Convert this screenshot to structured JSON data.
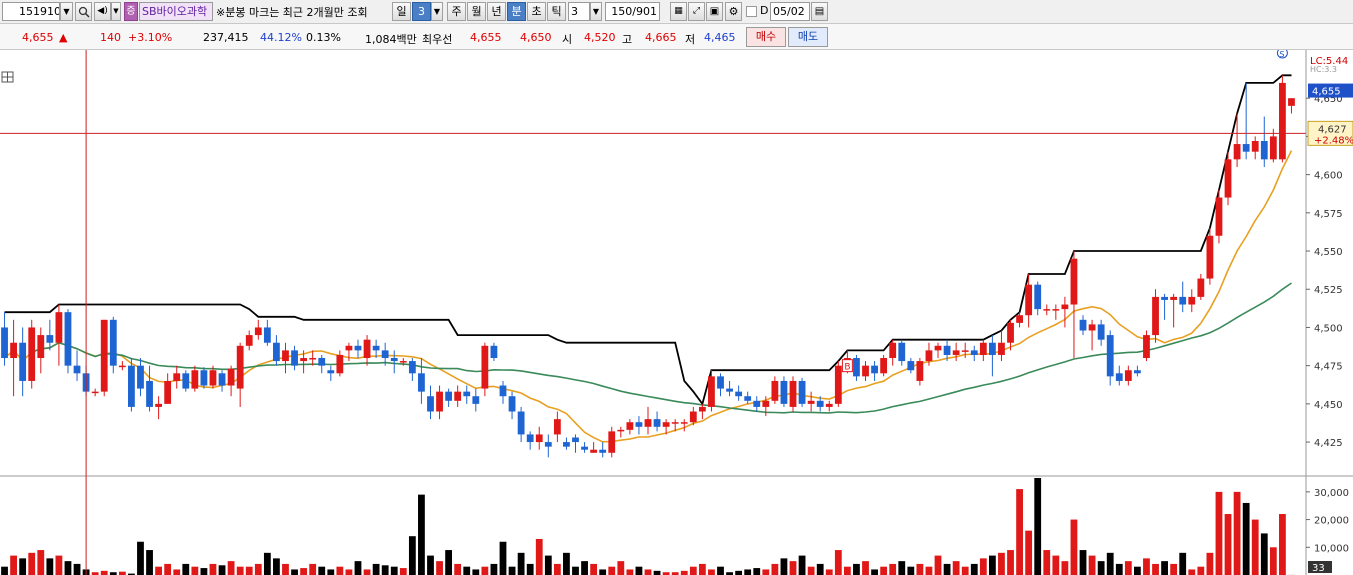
{
  "toolbar": {
    "code": "151910",
    "stock_name": "SB바이오과학",
    "notice": "※분봉 마크는 최근 2개월만 조회",
    "period_day": "일",
    "period_num": "3",
    "week": "주",
    "month": "월",
    "year": "년",
    "minute": "분",
    "second": "초",
    "tick": "틱",
    "interval": "3",
    "count": "150",
    "total": "/901",
    "d_label": "D",
    "date": "05/02"
  },
  "quote": {
    "price": "4,655",
    "change": "140",
    "change_pct": "+3.10%",
    "volume": "237,415",
    "vol_ratio": "44.12%",
    "turnover_pct": "0.13%",
    "amount": "1,084백만",
    "best_label": "최우선",
    "ask": "4,655",
    "bid": "4,650",
    "open_label": "시",
    "open": "4,520",
    "high_label": "고",
    "high": "4,665",
    "low_label": "저",
    "low": "4,465",
    "buy": "매수",
    "sell": "매도"
  },
  "price_axis": {
    "ticks": [
      "4,650",
      "4,625",
      "4,600",
      "4,575",
      "4,550",
      "4,525",
      "4,500",
      "4,475",
      "4,450",
      "4,425"
    ],
    "current_badge": "4,655",
    "cursor_price": "4,627",
    "cursor_pct": "+2.48%",
    "lc_label": "LC:5.44",
    "hc_label": "HC:3.3"
  },
  "volume_axis": {
    "ticks": [
      "30,000",
      "20,000",
      "10,000"
    ],
    "current": "33"
  },
  "colors": {
    "up": "#e01818",
    "down": "#1e64d2",
    "ma_short": "#e8a020",
    "ma_long": "#3a8a5a",
    "envelope": "#000000",
    "cursor": "#cc2020"
  },
  "chart_data": {
    "type": "candlestick",
    "y_price_range": [
      4410,
      4675
    ],
    "y_volume_range": [
      0,
      35000
    ],
    "markers": [
      "B",
      "S"
    ],
    "candles": [
      {
        "o": 4500,
        "h": 4510,
        "l": 4475,
        "c": 4480,
        "v": 3000
      },
      {
        "o": 4480,
        "h": 4505,
        "l": 4455,
        "c": 4490,
        "v": 7000
      },
      {
        "o": 4490,
        "h": 4500,
        "l": 4455,
        "c": 4465,
        "v": 6000
      },
      {
        "o": 4465,
        "h": 4505,
        "l": 4460,
        "c": 4500,
        "v": 8000
      },
      {
        "o": 4480,
        "h": 4500,
        "l": 4470,
        "c": 4495,
        "v": 9000
      },
      {
        "o": 4495,
        "h": 4505,
        "l": 4485,
        "c": 4490,
        "v": 6000
      },
      {
        "o": 4490,
        "h": 4515,
        "l": 4475,
        "c": 4510,
        "v": 7000
      },
      {
        "o": 4510,
        "h": 4512,
        "l": 4470,
        "c": 4475,
        "v": 5000
      },
      {
        "o": 4475,
        "h": 4485,
        "l": 4465,
        "c": 4470,
        "v": 4000
      },
      {
        "o": 4470,
        "h": 4475,
        "l": 4455,
        "c": 4458,
        "v": 2000
      },
      {
        "o": 4458,
        "h": 4460,
        "l": 4455,
        "c": 4458,
        "v": 1000
      },
      {
        "o": 4458,
        "h": 4505,
        "l": 4455,
        "c": 4505,
        "v": 1500
      },
      {
        "o": 4505,
        "h": 4507,
        "l": 4470,
        "c": 4475,
        "v": 1000
      },
      {
        "o": 4475,
        "h": 4478,
        "l": 4472,
        "c": 4475,
        "v": 1200
      },
      {
        "o": 4475,
        "h": 4480,
        "l": 4445,
        "c": 4448,
        "v": 500
      },
      {
        "o": 4475,
        "h": 4480,
        "l": 4455,
        "c": 4460,
        "v": 12000
      },
      {
        "o": 4465,
        "h": 4475,
        "l": 4445,
        "c": 4448,
        "v": 9000
      },
      {
        "o": 4448,
        "h": 4455,
        "l": 4440,
        "c": 4450,
        "v": 3000
      },
      {
        "o": 4450,
        "h": 4470,
        "l": 4450,
        "c": 4465,
        "v": 4000
      },
      {
        "o": 4465,
        "h": 4475,
        "l": 4460,
        "c": 4470,
        "v": 2000
      },
      {
        "o": 4470,
        "h": 4472,
        "l": 4458,
        "c": 4460,
        "v": 4000
      },
      {
        "o": 4460,
        "h": 4475,
        "l": 4458,
        "c": 4472,
        "v": 3000
      },
      {
        "o": 4472,
        "h": 4474,
        "l": 4460,
        "c": 4462,
        "v": 2500
      },
      {
        "o": 4462,
        "h": 4475,
        "l": 4460,
        "c": 4472,
        "v": 4000
      },
      {
        "o": 4470,
        "h": 4472,
        "l": 4458,
        "c": 4462,
        "v": 3500
      },
      {
        "o": 4462,
        "h": 4475,
        "l": 4455,
        "c": 4473,
        "v": 5000
      },
      {
        "o": 4460,
        "h": 4490,
        "l": 4448,
        "c": 4488,
        "v": 3000
      },
      {
        "o": 4488,
        "h": 4498,
        "l": 4485,
        "c": 4495,
        "v": 3000
      },
      {
        "o": 4495,
        "h": 4505,
        "l": 4492,
        "c": 4500,
        "v": 4000
      },
      {
        "o": 4500,
        "h": 4505,
        "l": 4488,
        "c": 4490,
        "v": 8000
      },
      {
        "o": 4490,
        "h": 4495,
        "l": 4475,
        "c": 4478,
        "v": 6000
      },
      {
        "o": 4478,
        "h": 4490,
        "l": 4470,
        "c": 4485,
        "v": 4000
      },
      {
        "o": 4485,
        "h": 4488,
        "l": 4472,
        "c": 4475,
        "v": 2000
      },
      {
        "o": 4478,
        "h": 4485,
        "l": 4470,
        "c": 4480,
        "v": 2500
      },
      {
        "o": 4480,
        "h": 4485,
        "l": 4475,
        "c": 4480,
        "v": 4000
      },
      {
        "o": 4480,
        "h": 4482,
        "l": 4470,
        "c": 4475,
        "v": 3000
      },
      {
        "o": 4472,
        "h": 4475,
        "l": 4465,
        "c": 4470,
        "v": 2000
      },
      {
        "o": 4470,
        "h": 4485,
        "l": 4468,
        "c": 4482,
        "v": 3000
      },
      {
        "o": 4485,
        "h": 4490,
        "l": 4478,
        "c": 4488,
        "v": 2000
      },
      {
        "o": 4488,
        "h": 4492,
        "l": 4480,
        "c": 4485,
        "v": 5000
      },
      {
        "o": 4480,
        "h": 4495,
        "l": 4475,
        "c": 4492,
        "v": 2000
      },
      {
        "o": 4488,
        "h": 4492,
        "l": 4480,
        "c": 4485,
        "v": 4000
      },
      {
        "o": 4485,
        "h": 4490,
        "l": 4475,
        "c": 4480,
        "v": 3500
      },
      {
        "o": 4480,
        "h": 4485,
        "l": 4470,
        "c": 4478,
        "v": 3000
      },
      {
        "o": 4478,
        "h": 4480,
        "l": 4475,
        "c": 4478,
        "v": 2500
      },
      {
        "o": 4478,
        "h": 4480,
        "l": 4465,
        "c": 4470,
        "v": 14000
      },
      {
        "o": 4470,
        "h": 4480,
        "l": 4450,
        "c": 4458,
        "v": 29000
      },
      {
        "o": 4455,
        "h": 4462,
        "l": 4440,
        "c": 4445,
        "v": 7000
      },
      {
        "o": 4445,
        "h": 4462,
        "l": 4440,
        "c": 4458,
        "v": 5000
      },
      {
        "o": 4458,
        "h": 4460,
        "l": 4448,
        "c": 4452,
        "v": 9000
      },
      {
        "o": 4452,
        "h": 4462,
        "l": 4448,
        "c": 4458,
        "v": 4000
      },
      {
        "o": 4458,
        "h": 4462,
        "l": 4450,
        "c": 4455,
        "v": 3000
      },
      {
        "o": 4455,
        "h": 4460,
        "l": 4445,
        "c": 4450,
        "v": 2000
      },
      {
        "o": 4460,
        "h": 4490,
        "l": 4455,
        "c": 4488,
        "v": 3000
      },
      {
        "o": 4488,
        "h": 4490,
        "l": 4478,
        "c": 4480,
        "v": 4000
      },
      {
        "o": 4462,
        "h": 4465,
        "l": 4450,
        "c": 4455,
        "v": 12000
      },
      {
        "o": 4455,
        "h": 4458,
        "l": 4440,
        "c": 4445,
        "v": 3000
      },
      {
        "o": 4445,
        "h": 4448,
        "l": 4425,
        "c": 4430,
        "v": 8000
      },
      {
        "o": 4430,
        "h": 4432,
        "l": 4420,
        "c": 4425,
        "v": 4000
      },
      {
        "o": 4425,
        "h": 4435,
        "l": 4420,
        "c": 4430,
        "v": 13000
      },
      {
        "o": 4425,
        "h": 4430,
        "l": 4415,
        "c": 4422,
        "v": 7000
      },
      {
        "o": 4430,
        "h": 4445,
        "l": 4425,
        "c": 4440,
        "v": 4000
      },
      {
        "o": 4425,
        "h": 4428,
        "l": 4420,
        "c": 4422,
        "v": 8000
      },
      {
        "o": 4428,
        "h": 4430,
        "l": 4418,
        "c": 4425,
        "v": 3000
      },
      {
        "o": 4422,
        "h": 4425,
        "l": 4418,
        "c": 4420,
        "v": 5000
      },
      {
        "o": 4418,
        "h": 4425,
        "l": 4418,
        "c": 4420,
        "v": 4000
      },
      {
        "o": 4420,
        "h": 4425,
        "l": 4415,
        "c": 4418,
        "v": 2000
      },
      {
        "o": 4418,
        "h": 4435,
        "l": 4415,
        "c": 4432,
        "v": 3000
      },
      {
        "o": 4432,
        "h": 4435,
        "l": 4428,
        "c": 4433,
        "v": 5000
      },
      {
        "o": 4433,
        "h": 4440,
        "l": 4430,
        "c": 4438,
        "v": 2000
      },
      {
        "o": 4438,
        "h": 4442,
        "l": 4430,
        "c": 4435,
        "v": 3000
      },
      {
        "o": 4435,
        "h": 4448,
        "l": 4430,
        "c": 4440,
        "v": 2000
      },
      {
        "o": 4440,
        "h": 4445,
        "l": 4432,
        "c": 4435,
        "v": 1500
      },
      {
        "o": 4435,
        "h": 4440,
        "l": 4430,
        "c": 4438,
        "v": 1000
      },
      {
        "o": 4438,
        "h": 4440,
        "l": 4432,
        "c": 4438,
        "v": 1000
      },
      {
        "o": 4438,
        "h": 4440,
        "l": 4432,
        "c": 4438,
        "v": 1500
      },
      {
        "o": 4438,
        "h": 4448,
        "l": 4436,
        "c": 4445,
        "v": 3000
      },
      {
        "o": 4445,
        "h": 4450,
        "l": 4440,
        "c": 4448,
        "v": 4000
      },
      {
        "o": 4448,
        "h": 4472,
        "l": 4445,
        "c": 4468,
        "v": 2000
      },
      {
        "o": 4468,
        "h": 4470,
        "l": 4455,
        "c": 4460,
        "v": 3000
      },
      {
        "o": 4460,
        "h": 4465,
        "l": 4455,
        "c": 4458,
        "v": 1000
      },
      {
        "o": 4458,
        "h": 4462,
        "l": 4452,
        "c": 4455,
        "v": 1500
      },
      {
        "o": 4455,
        "h": 4458,
        "l": 4450,
        "c": 4452,
        "v": 2000
      },
      {
        "o": 4452,
        "h": 4455,
        "l": 4445,
        "c": 4448,
        "v": 2500
      },
      {
        "o": 4448,
        "h": 4455,
        "l": 4442,
        "c": 4452,
        "v": 2000
      },
      {
        "o": 4452,
        "h": 4468,
        "l": 4450,
        "c": 4465,
        "v": 4000
      },
      {
        "o": 4465,
        "h": 4468,
        "l": 4448,
        "c": 4450,
        "v": 6000
      },
      {
        "o": 4448,
        "h": 4468,
        "l": 4445,
        "c": 4465,
        "v": 5000
      },
      {
        "o": 4465,
        "h": 4467,
        "l": 4448,
        "c": 4450,
        "v": 7000
      },
      {
        "o": 4450,
        "h": 4458,
        "l": 4445,
        "c": 4452,
        "v": 3000
      },
      {
        "o": 4452,
        "h": 4455,
        "l": 4445,
        "c": 4448,
        "v": 4000
      },
      {
        "o": 4448,
        "h": 4452,
        "l": 4445,
        "c": 4450,
        "v": 2000
      },
      {
        "o": 4450,
        "h": 4478,
        "l": 4448,
        "c": 4475,
        "v": 9000
      },
      {
        "o": 4475,
        "h": 4485,
        "l": 4470,
        "c": 4480,
        "v": 3000
      },
      {
        "o": 4480,
        "h": 4482,
        "l": 4465,
        "c": 4468,
        "v": 4000
      },
      {
        "o": 4468,
        "h": 4478,
        "l": 4465,
        "c": 4475,
        "v": 5000
      },
      {
        "o": 4475,
        "h": 4478,
        "l": 4465,
        "c": 4470,
        "v": 2000
      },
      {
        "o": 4470,
        "h": 4482,
        "l": 4468,
        "c": 4480,
        "v": 3000
      },
      {
        "o": 4480,
        "h": 4492,
        "l": 4475,
        "c": 4490,
        "v": 4000
      },
      {
        "o": 4490,
        "h": 4492,
        "l": 4475,
        "c": 4478,
        "v": 5000
      },
      {
        "o": 4478,
        "h": 4480,
        "l": 4470,
        "c": 4472,
        "v": 3000
      },
      {
        "o": 4465,
        "h": 4480,
        "l": 4462,
        "c": 4478,
        "v": 4000
      },
      {
        "o": 4478,
        "h": 4490,
        "l": 4475,
        "c": 4485,
        "v": 3000
      },
      {
        "o": 4485,
        "h": 4490,
        "l": 4480,
        "c": 4488,
        "v": 7000
      },
      {
        "o": 4488,
        "h": 4492,
        "l": 4478,
        "c": 4482,
        "v": 4000
      },
      {
        "o": 4482,
        "h": 4490,
        "l": 4478,
        "c": 4485,
        "v": 5000
      },
      {
        "o": 4485,
        "h": 4490,
        "l": 4480,
        "c": 4485,
        "v": 3000
      },
      {
        "o": 4485,
        "h": 4488,
        "l": 4478,
        "c": 4482,
        "v": 4000
      },
      {
        "o": 4482,
        "h": 4492,
        "l": 4478,
        "c": 4490,
        "v": 6000
      },
      {
        "o": 4490,
        "h": 4495,
        "l": 4468,
        "c": 4482,
        "v": 7000
      },
      {
        "o": 4482,
        "h": 4498,
        "l": 4478,
        "c": 4490,
        "v": 8000
      },
      {
        "o": 4490,
        "h": 4505,
        "l": 4485,
        "c": 4503,
        "v": 9000
      },
      {
        "o": 4503,
        "h": 4510,
        "l": 4500,
        "c": 4508,
        "v": 31000
      },
      {
        "o": 4508,
        "h": 4535,
        "l": 4500,
        "c": 4528,
        "v": 16000
      },
      {
        "o": 4528,
        "h": 4530,
        "l": 4508,
        "c": 4512,
        "v": 35000
      },
      {
        "o": 4512,
        "h": 4515,
        "l": 4508,
        "c": 4512,
        "v": 9000
      },
      {
        "o": 4512,
        "h": 4515,
        "l": 4505,
        "c": 4512,
        "v": 7000
      },
      {
        "o": 4512,
        "h": 4520,
        "l": 4500,
        "c": 4515,
        "v": 5000
      },
      {
        "o": 4515,
        "h": 4550,
        "l": 4480,
        "c": 4545,
        "v": 20000
      },
      {
        "o": 4505,
        "h": 4508,
        "l": 4495,
        "c": 4498,
        "v": 9000
      },
      {
        "o": 4498,
        "h": 4505,
        "l": 4485,
        "c": 4502,
        "v": 7000
      },
      {
        "o": 4502,
        "h": 4505,
        "l": 4488,
        "c": 4492,
        "v": 5000
      },
      {
        "o": 4495,
        "h": 4498,
        "l": 4462,
        "c": 4468,
        "v": 8000
      },
      {
        "o": 4470,
        "h": 4475,
        "l": 4462,
        "c": 4465,
        "v": 4000
      },
      {
        "o": 4465,
        "h": 4475,
        "l": 4462,
        "c": 4472,
        "v": 5000
      },
      {
        "o": 4472,
        "h": 4475,
        "l": 4468,
        "c": 4470,
        "v": 3000
      },
      {
        "o": 4480,
        "h": 4498,
        "l": 4478,
        "c": 4495,
        "v": 6000
      },
      {
        "o": 4495,
        "h": 4525,
        "l": 4490,
        "c": 4520,
        "v": 4000
      },
      {
        "o": 4520,
        "h": 4522,
        "l": 4505,
        "c": 4518,
        "v": 5000
      },
      {
        "o": 4518,
        "h": 4522,
        "l": 4500,
        "c": 4520,
        "v": 4000
      },
      {
        "o": 4520,
        "h": 4530,
        "l": 4510,
        "c": 4515,
        "v": 8000
      },
      {
        "o": 4515,
        "h": 4525,
        "l": 4510,
        "c": 4520,
        "v": 2000
      },
      {
        "o": 4520,
        "h": 4535,
        "l": 4518,
        "c": 4532,
        "v": 3000
      },
      {
        "o": 4532,
        "h": 4565,
        "l": 4528,
        "c": 4560,
        "v": 8000
      },
      {
        "o": 4560,
        "h": 4590,
        "l": 4555,
        "c": 4585,
        "v": 30000
      },
      {
        "o": 4585,
        "h": 4615,
        "l": 4580,
        "c": 4610,
        "v": 22000
      },
      {
        "o": 4610,
        "h": 4640,
        "l": 4605,
        "c": 4620,
        "v": 30000
      },
      {
        "o": 4620,
        "h": 4660,
        "l": 4610,
        "c": 4615,
        "v": 26000
      },
      {
        "o": 4615,
        "h": 4625,
        "l": 4610,
        "c": 4622,
        "v": 20000
      },
      {
        "o": 4622,
        "h": 4638,
        "l": 4605,
        "c": 4610,
        "v": 15000
      },
      {
        "o": 4610,
        "h": 4630,
        "l": 4608,
        "c": 4625,
        "v": 10000
      },
      {
        "o": 4610,
        "h": 4665,
        "l": 4608,
        "c": 4660,
        "v": 22000
      },
      {
        "o": 4645,
        "h": 4650,
        "l": 4640,
        "c": 4650,
        "v": 33
      }
    ]
  }
}
